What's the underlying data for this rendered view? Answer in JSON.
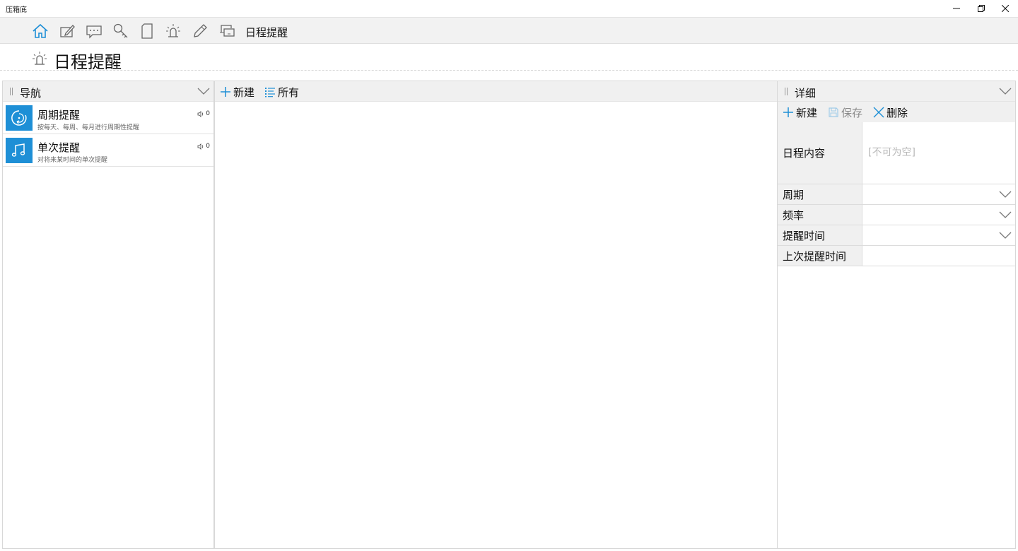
{
  "window": {
    "title": "压箱底",
    "controls": {
      "minimize": "minimize-icon",
      "restore": "restore-icon",
      "close": "close-icon"
    }
  },
  "toolbar": {
    "icons": [
      "home-icon",
      "edit-icon",
      "message-icon",
      "key-icon",
      "note-icon",
      "bell-icon",
      "pencil-icon",
      "monitor-icon"
    ],
    "active_label": "日程提醒",
    "accent": "#1e8fd6"
  },
  "page": {
    "title": "日程提醒",
    "icon": "bell-icon"
  },
  "nav_panel": {
    "title": "导航",
    "items": [
      {
        "title": "周期提醒",
        "subtitle": "按每天、每周、每月进行周期性提醒",
        "count": "0",
        "icon": "cycle-icon"
      },
      {
        "title": "单次提醒",
        "subtitle": "对将来某时间的单次提醒",
        "count": "0",
        "icon": "music-note-icon"
      }
    ]
  },
  "list_panel": {
    "new_label": "新建",
    "all_label": "所有"
  },
  "detail_panel": {
    "title": "详细",
    "new_label": "新建",
    "save_label": "保存",
    "delete_label": "删除",
    "fields": {
      "content_label": "日程内容",
      "content_placeholder": "[不可为空]",
      "cycle_label": "周期",
      "frequency_label": "频率",
      "remind_time_label": "提醒时间",
      "last_remind_label": "上次提醒时间"
    }
  }
}
